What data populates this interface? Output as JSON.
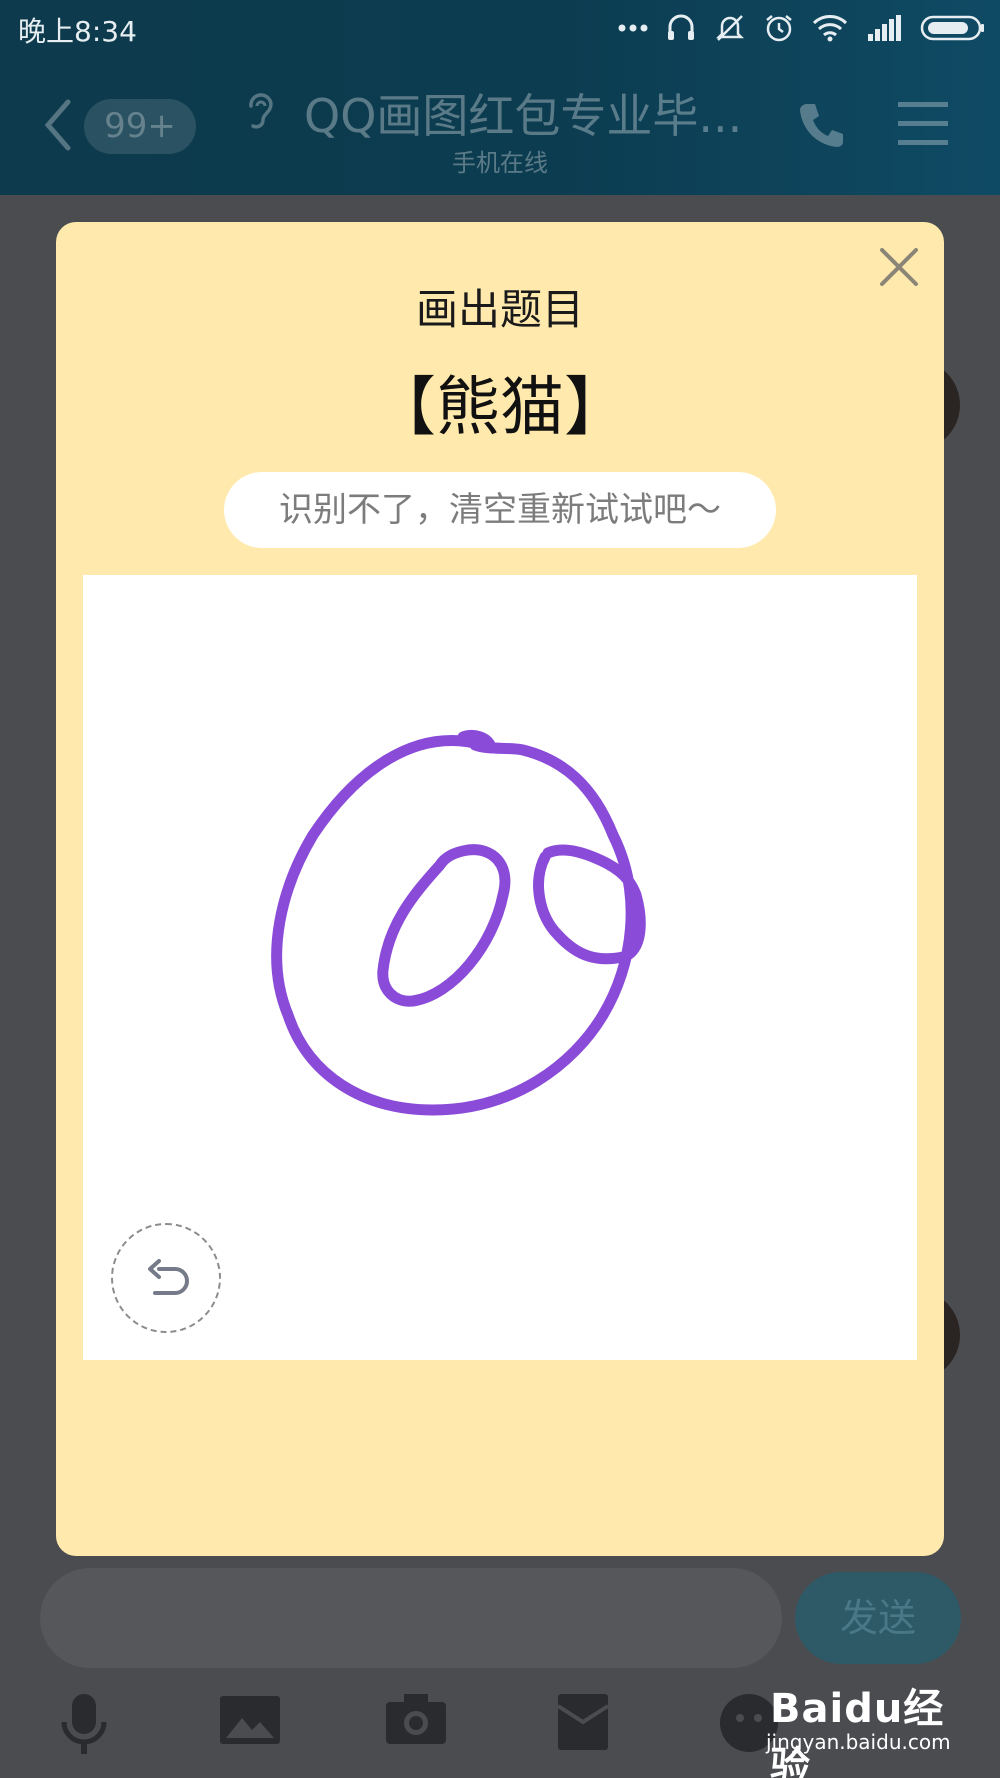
{
  "status_bar": {
    "time": "晚上8:34",
    "icons": [
      "more-dots-icon",
      "headset-icon",
      "mute-icon",
      "alarm-icon",
      "wifi-icon",
      "signal-icon",
      "battery-icon"
    ]
  },
  "chat_header": {
    "unread_badge": "99+",
    "title": "QQ画图红包专业毕...",
    "subtitle": "手机在线"
  },
  "modal": {
    "title": "画出题目",
    "topic": "【熊猫】",
    "hint": "识别不了，清空重新试试吧～",
    "drawing_color": "#8a4bd9",
    "background_color": "#ffe9ac"
  },
  "input_bar": {
    "send_label": "发送"
  },
  "toolbar": {
    "icons": [
      "microphone-icon",
      "image-icon",
      "camera-icon",
      "red-packet-icon",
      "emoji-icon"
    ]
  },
  "watermark": {
    "brand": "Baidu经验",
    "url": "jingyan.baidu.com"
  }
}
